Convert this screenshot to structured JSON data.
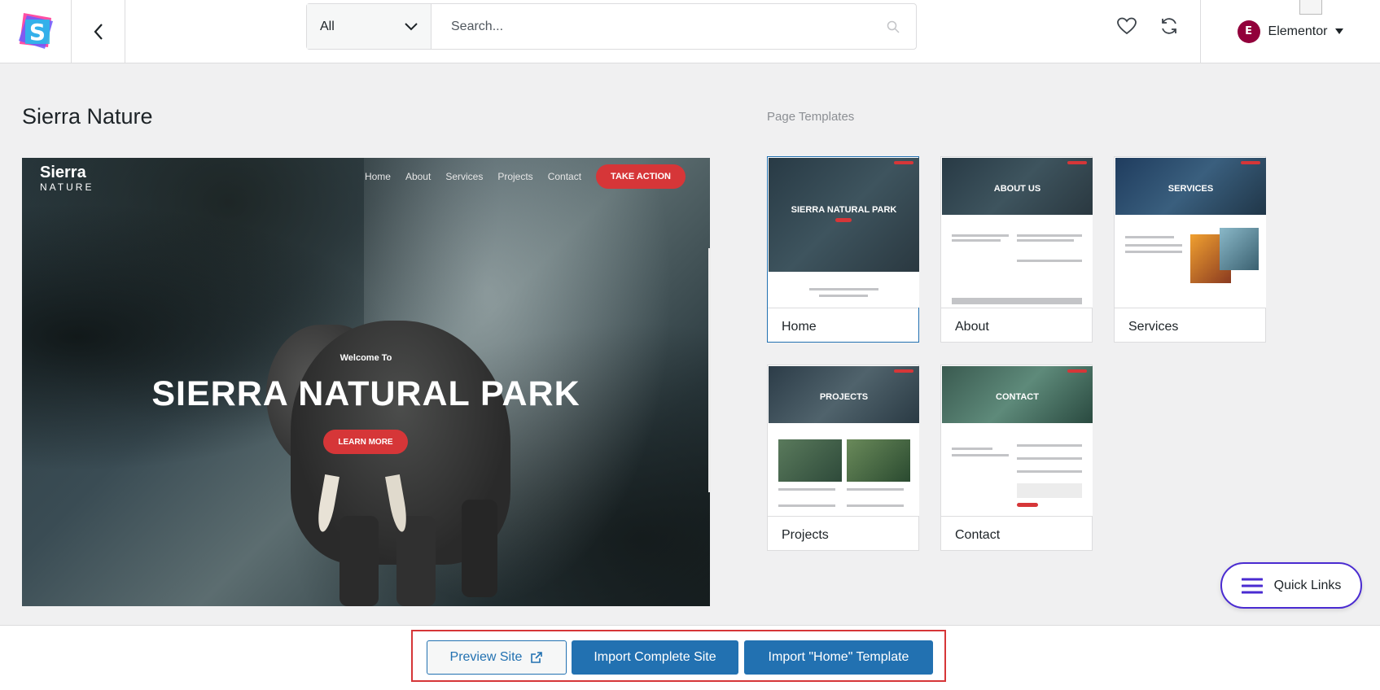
{
  "header": {
    "filter_value": "All",
    "search_placeholder": "Search...",
    "builder_label": "Elementor",
    "builder_badge": "E"
  },
  "site": {
    "title": "Sierra Nature"
  },
  "preview": {
    "logo_big": "Sierra",
    "logo_small": "NATURE",
    "nav": [
      "Home",
      "About",
      "Services",
      "Projects",
      "Contact"
    ],
    "cta": "TAKE ACTION",
    "welcome": "Welcome To",
    "heading": "SIERRA NATURAL PARK",
    "button": "LEARN MORE"
  },
  "page_templates": {
    "label": "Page Templates",
    "items": [
      {
        "label": "Home",
        "hero": "SIERRA NATURAL PARK"
      },
      {
        "label": "About",
        "hero": "ABOUT US"
      },
      {
        "label": "Services",
        "hero": "SERVICES"
      },
      {
        "label": "Projects",
        "hero": "PROJECTS"
      },
      {
        "label": "Contact",
        "hero": "CONTACT"
      }
    ]
  },
  "quick_links": {
    "label": "Quick Links"
  },
  "footer": {
    "preview_label": "Preview Site",
    "import_complete_label": "Import Complete Site",
    "import_template_label": "Import \"Home\" Template"
  }
}
